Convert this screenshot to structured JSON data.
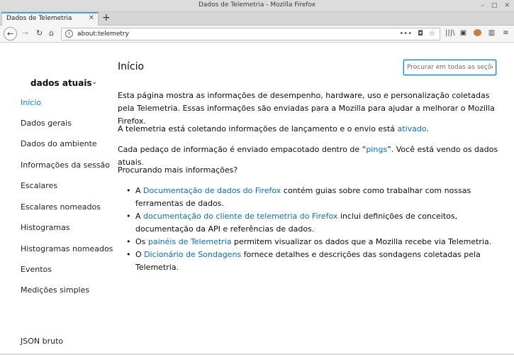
{
  "window": {
    "title": "Dados de Telemetria - Mozilla Firefox",
    "minimize": "–",
    "maximize": "□",
    "close": "✕"
  },
  "tabs": [
    {
      "label": "Dados de Telemetria",
      "close": "✕"
    }
  ],
  "new_tab": "+",
  "nav": {
    "back": "←",
    "forward": "→",
    "reload": "↻",
    "home": "⌂",
    "info": "i",
    "url": "about:telemetry",
    "page_actions": "•••",
    "pocket": "◘",
    "bookmark": "☆",
    "tools": [
      "|||\\",
      "▣",
      "●",
      "▥",
      "≡"
    ]
  },
  "sidebar": {
    "category": "dados atuais",
    "chevron": "⌄",
    "items": [
      {
        "label": "Início",
        "active": true
      },
      {
        "label": "Dados gerais"
      },
      {
        "label": "Dados do ambiente"
      },
      {
        "label": "Informações da sessão"
      },
      {
        "label": "Escalares"
      },
      {
        "label": "Escalares nomeados"
      },
      {
        "label": "Histogramas"
      },
      {
        "label": "Histogramas nomeados"
      },
      {
        "label": "Eventos"
      },
      {
        "label": "Medições simples"
      }
    ],
    "raw_json": "JSON bruto"
  },
  "main": {
    "title": "Início",
    "search_placeholder": "Procurar em todas as seções",
    "p1": "Esta página mostra as informações de desempenho, hardware, uso e personalização coletadas pela Telemetria. Essas informações são enviadas para a Mozilla para ajudar a melhorar o Mozilla Firefox.",
    "p2_pre": "A telemetria está coletando informações de lançamento e o envio está ",
    "p2_link": "ativado",
    "p2_post": ".",
    "p3_pre": "Cada pedaço de informação é enviado empacotado dentro de “",
    "p3_link": "pings",
    "p3_post": "”. Você está vendo os dados atuais.",
    "p4": "Procurando mais informações?",
    "bullets": [
      {
        "pre": "A ",
        "link": "Documentação de dados do Firefox",
        "post": " contém guias sobre como trabalhar com nossas ferramentas de dados."
      },
      {
        "pre": "A ",
        "link": "documentação do cliente de telemetria do Firefox",
        "post": " inclui definições de conceitos, documentação da API e referências de dados."
      },
      {
        "pre": "Os ",
        "link": "painéis de Telemetria",
        "post": " permitem visualizar os dados que a Mozilla recebe via Telemetria."
      },
      {
        "pre": "O ",
        "link": "Dicionário de Sondagens",
        "post": " fornece detalhes e descrições das sondagens coletadas pela Telemetria."
      }
    ]
  },
  "colors": {
    "accent": "#0a84ff",
    "link": "#0a6dc4"
  }
}
